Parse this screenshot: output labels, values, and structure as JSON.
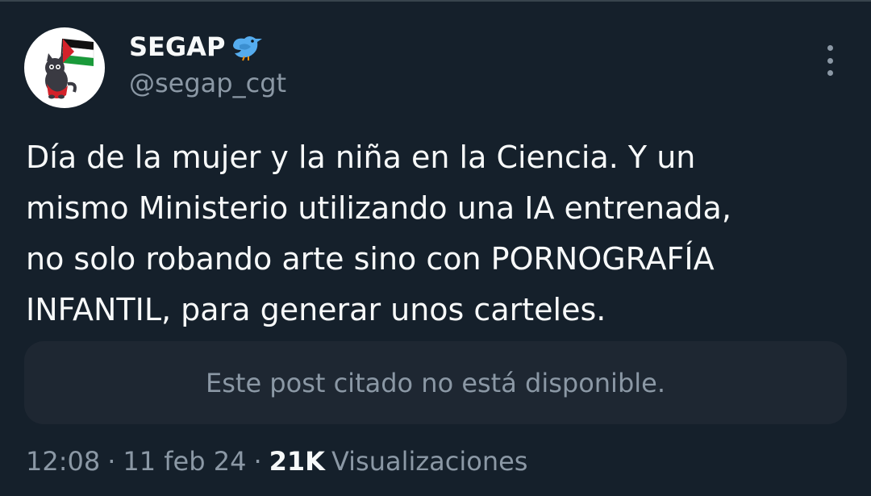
{
  "colors": {
    "background": "#15202b",
    "text_primary": "#f7f9f9",
    "text_secondary": "#8b98a5",
    "quote_background": "#1e2732"
  },
  "author": {
    "display_name": "SEGAP",
    "name_emoji_icon": "bird-icon",
    "handle": "@segap_cgt",
    "avatar_icon": "cat-with-palestine-flag-avatar"
  },
  "more_menu": {
    "icon": "more-vertical-icon"
  },
  "tweet": {
    "lines": [
      "Día de la mujer y la niña en la Ciencia. Y un",
      "mismo Ministerio utilizando una IA entrenada,",
      "no solo robando arte sino con PORNOGRAFÍA",
      "INFANTIL, para generar unos carteles."
    ]
  },
  "quoted_post": {
    "unavailable_text": "Este post citado no está disponible."
  },
  "meta": {
    "time": "12:08",
    "separator": "·",
    "date": "11 feb 24",
    "views_count": "21K",
    "views_label": "Visualizaciones"
  }
}
